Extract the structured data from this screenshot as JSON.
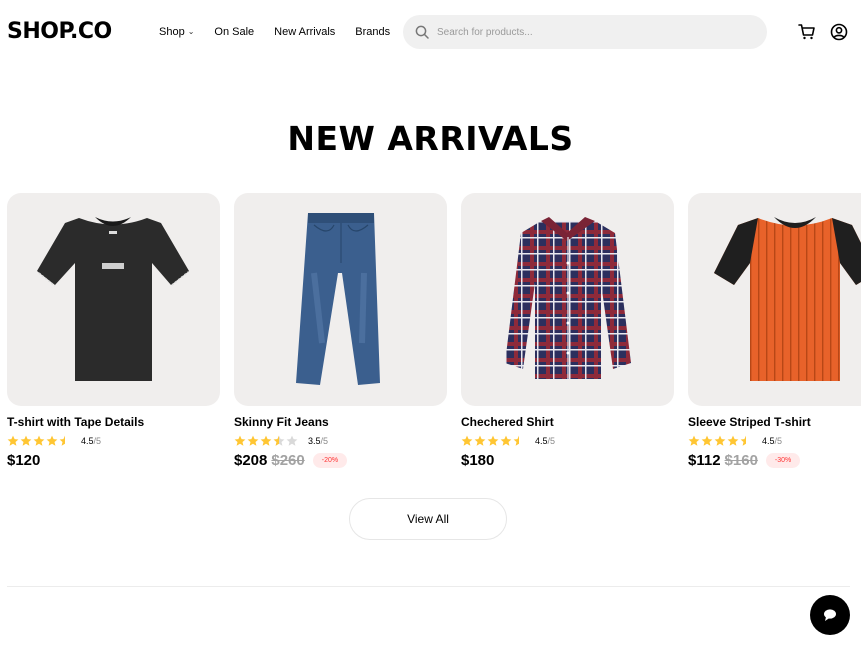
{
  "header": {
    "logo": "SHOP.CO",
    "nav": [
      {
        "label": "Shop",
        "has_dropdown": true
      },
      {
        "label": "On Sale"
      },
      {
        "label": "New Arrivals"
      },
      {
        "label": "Brands"
      }
    ],
    "search_placeholder": "Search for products...",
    "icons": [
      "search-icon",
      "cart-icon",
      "account-icon"
    ]
  },
  "section": {
    "title": "NEW ARRIVALS",
    "view_all_label": "View All"
  },
  "products": [
    {
      "name": "T-shirt with Tape Details",
      "rating": 4.5,
      "rating_value": "4.5",
      "rating_max": "/5",
      "price": "$120",
      "old_price": "",
      "discount": "",
      "image": "black-tshirt"
    },
    {
      "name": "Skinny Fit Jeans",
      "rating": 3.5,
      "rating_value": "3.5",
      "rating_max": "/5",
      "price": "$208",
      "old_price": "$260",
      "discount": "-20%",
      "image": "blue-jeans"
    },
    {
      "name": "Chechered Shirt",
      "rating": 4.5,
      "rating_value": "4.5",
      "rating_max": "/5",
      "price": "$180",
      "old_price": "",
      "discount": "",
      "image": "checkered-shirt"
    },
    {
      "name": "Sleeve Striped T-shirt",
      "rating": 4.5,
      "rating_value": "4.5",
      "rating_max": "/5",
      "price": "$112",
      "old_price": "$160",
      "discount": "-30%",
      "image": "striped-tshirt"
    }
  ],
  "colors": {
    "star": "#FFC633",
    "card_bg": "#F0EEED",
    "discount_text": "#FF3333",
    "discount_bg": "#FFEAEA"
  },
  "floating": {
    "chat_icon": "chat-icon"
  }
}
